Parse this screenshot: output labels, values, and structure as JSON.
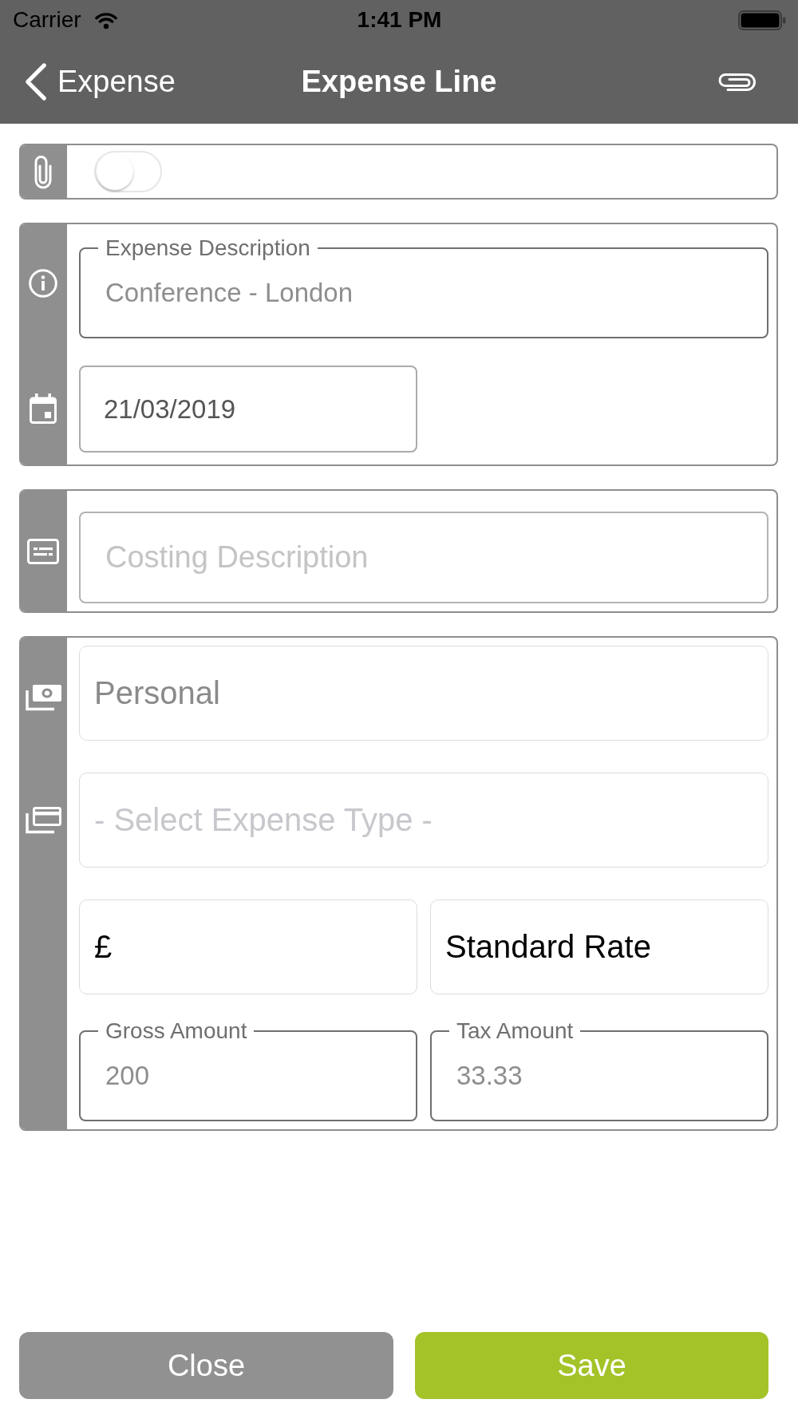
{
  "status_bar": {
    "carrier": "Carrier",
    "time": "1:41 PM"
  },
  "nav_bar": {
    "back_label": "Expense",
    "title": "Expense Line"
  },
  "sections": [
    {
      "kind": "attachments",
      "toggle": {
        "on": false
      }
    },
    {
      "kind": "details",
      "rows": [
        {
          "fields": [
            {
              "kind": "outlined",
              "label": "Expense Description",
              "value": "Conference - London"
            }
          ]
        },
        {
          "fields": [
            {
              "kind": "date",
              "value": "21/03/2019"
            }
          ]
        }
      ]
    },
    {
      "kind": "costing",
      "rows": [
        {
          "fields": [
            {
              "kind": "input",
              "placeholder": "Costing Description"
            }
          ]
        }
      ]
    },
    {
      "kind": "amounts",
      "rows": [
        {
          "fields": [
            {
              "kind": "picker",
              "value": "Personal",
              "disabled": true
            }
          ]
        },
        {
          "fields": [
            {
              "kind": "picker",
              "placeholder": "- Select Expense Type -",
              "disabled": false
            }
          ]
        },
        {
          "fields": [
            {
              "kind": "picker",
              "value": "£",
              "disabled": false
            },
            {
              "kind": "picker",
              "value": "Standard Rate",
              "disabled": false
            }
          ]
        },
        {
          "fields": [
            {
              "kind": "outlined",
              "label": "Gross Amount",
              "value": "200"
            },
            {
              "kind": "outlined",
              "label": "Tax Amount",
              "value": "33.33"
            }
          ]
        }
      ]
    }
  ],
  "buttons": [
    {
      "kind": "secondary",
      "label": "Close"
    },
    {
      "kind": "primary",
      "label": "Save"
    }
  ]
}
